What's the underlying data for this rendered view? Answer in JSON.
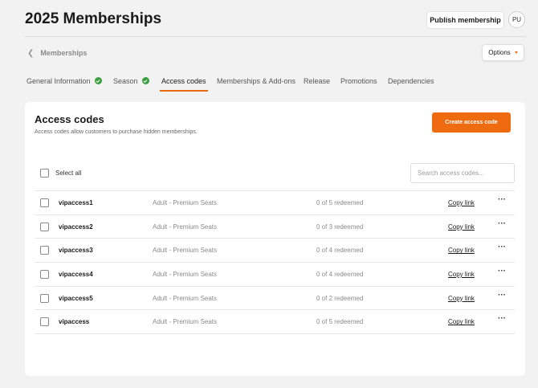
{
  "header": {
    "title": "2025 Memberships",
    "publish_label": "Publish membership",
    "avatar_initials": "PU"
  },
  "nav": {
    "back_label": "Memberships",
    "options_label": "Options"
  },
  "tabs": [
    {
      "label": "General Information",
      "completed": true,
      "active": false
    },
    {
      "label": "Season",
      "completed": true,
      "active": false
    },
    {
      "label": "Access codes",
      "completed": false,
      "active": true
    },
    {
      "label": "Memberships & Add-ons",
      "completed": false,
      "active": false
    },
    {
      "label": "Release",
      "completed": false,
      "active": false
    },
    {
      "label": "Promotions",
      "completed": false,
      "active": false
    },
    {
      "label": "Dependencies",
      "completed": false,
      "active": false
    }
  ],
  "card": {
    "title": "Access codes",
    "subtitle": "Access codes allow customers to purchase hidden memberships.",
    "create_label": "Create access code",
    "select_all_label": "Select all",
    "search_placeholder": "Search access codes..."
  },
  "codes": [
    {
      "code": "vipaccess1",
      "tier": "Adult - Premium Seats",
      "redeemed": "0 of 5 redeemed",
      "action": "Copy link"
    },
    {
      "code": "vipaccess2",
      "tier": "Adult - Premium Seats",
      "redeemed": "0 of 3 redeemed",
      "action": "Copy link"
    },
    {
      "code": "vipaccess3",
      "tier": "Adult - Premium Seats",
      "redeemed": "0 of 4 redeemed",
      "action": "Copy link"
    },
    {
      "code": "vipaccess4",
      "tier": "Adult - Premium Seats",
      "redeemed": "0 of 4 redeemed",
      "action": "Copy link"
    },
    {
      "code": "vipaccess5",
      "tier": "Adult - Premium Seats",
      "redeemed": "0 of 2 redeemed",
      "action": "Copy link"
    },
    {
      "code": "vipaccess",
      "tier": "Adult - Premium Seats",
      "redeemed": "0 of 5 redeemed",
      "action": "Copy link"
    }
  ],
  "colors": {
    "accent": "#ee6b10",
    "success": "#3b9e3f"
  }
}
